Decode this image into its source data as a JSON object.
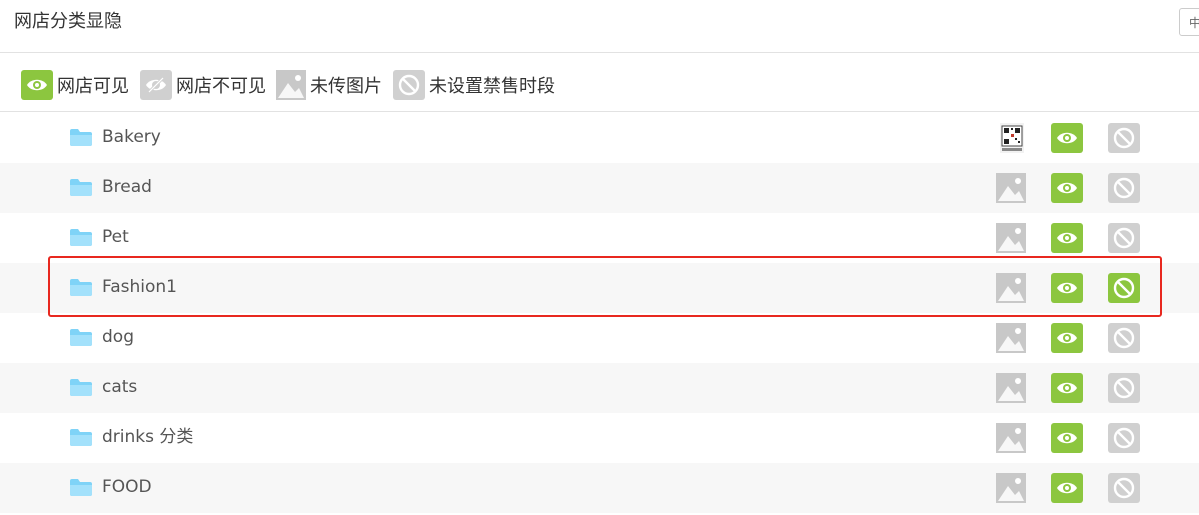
{
  "page": {
    "title": "网店分类显隐",
    "lang_indicator": "中"
  },
  "legend": [
    {
      "label": "网店可见",
      "icon": "eye-icon"
    },
    {
      "label": "网店不可见",
      "icon": "eye-slash-icon"
    },
    {
      "label": "未传图片",
      "icon": "image-placeholder-icon"
    },
    {
      "label": "未设置禁售时段",
      "icon": "ban-icon"
    }
  ],
  "categories": [
    {
      "name": "Bakery",
      "image": "qr-thumbnail",
      "visible": true,
      "restricted": false
    },
    {
      "name": "Bread",
      "image": "none",
      "visible": true,
      "restricted": false
    },
    {
      "name": "Pet",
      "image": "none",
      "visible": true,
      "restricted": false
    },
    {
      "name": "Fashion1",
      "image": "none",
      "visible": true,
      "restricted": true,
      "highlighted": true
    },
    {
      "name": "dog",
      "image": "none",
      "visible": true,
      "restricted": false
    },
    {
      "name": "cats",
      "image": "none",
      "visible": true,
      "restricted": false
    },
    {
      "name": "drinks 分类",
      "image": "none",
      "visible": true,
      "restricted": false
    },
    {
      "name": "FOOD",
      "image": "none",
      "visible": true,
      "restricted": false
    }
  ],
  "colors": {
    "visible_green": "#8cc63f",
    "inactive_gray": "#d0d0d0",
    "highlight_red": "#e8281f",
    "folder_blue": "#7fd3f7"
  }
}
